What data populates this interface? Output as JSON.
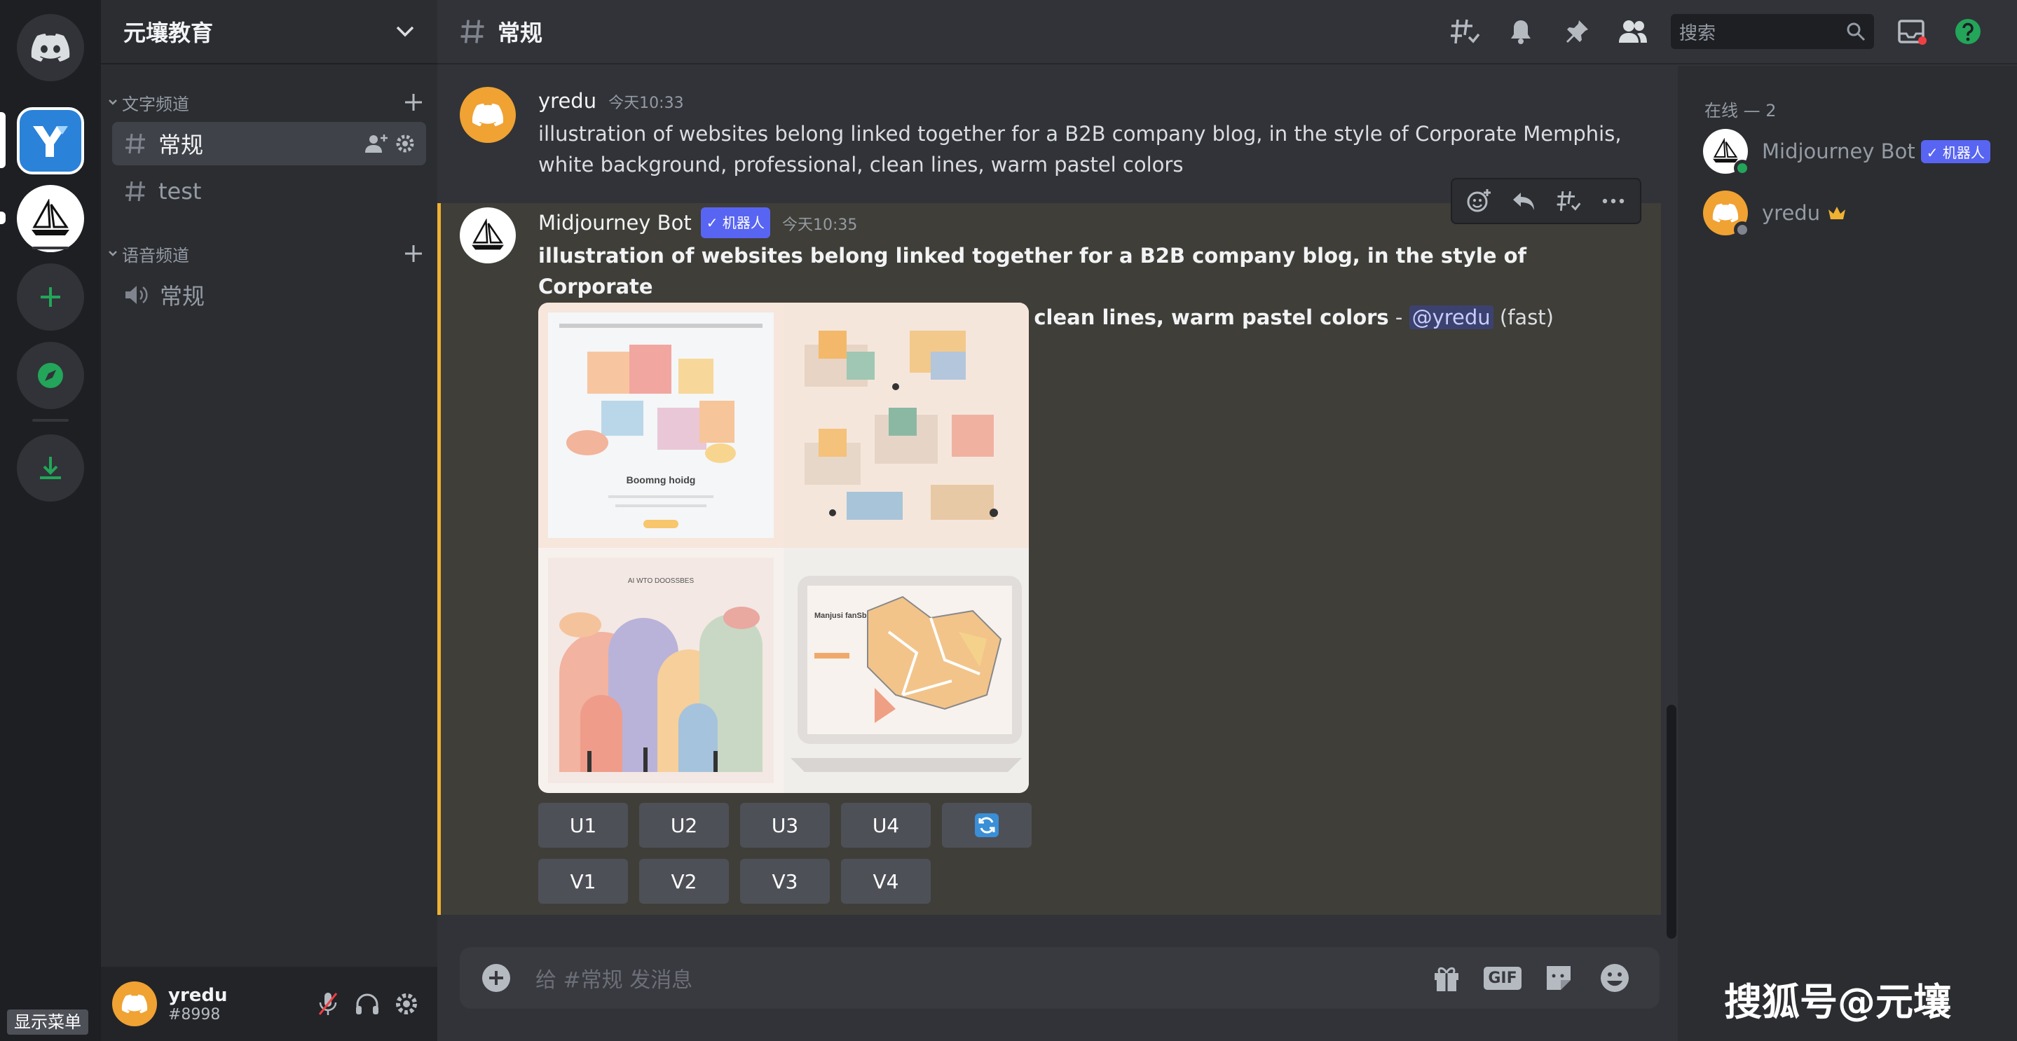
{
  "server_rail": {
    "menu_label": "显示菜单"
  },
  "sidebar": {
    "guild_name": "元壤教育",
    "categories": [
      {
        "label": "文字频道",
        "channels": [
          {
            "name": "常规"
          },
          {
            "name": "test"
          }
        ]
      },
      {
        "label": "语音频道",
        "channels": [
          {
            "name": "常规"
          }
        ]
      }
    ]
  },
  "user_panel": {
    "name": "yredu",
    "tag": "#8998"
  },
  "topbar": {
    "channel": "常规",
    "search_placeholder": "搜索"
  },
  "messages": [
    {
      "author": "yredu",
      "time": "今天10:33",
      "text_line1": "illustration of websites belong linked together for a B2B company blog, in the style of Corporate Memphis,",
      "text_line2": "white background, professional, clean lines, warm pastel colors"
    },
    {
      "author": "Midjourney Bot",
      "bot_tag": "机器人",
      "time": "今天10:35",
      "prompt_line1": "illustration of websites belong linked together for a B2B company blog, in the style of Corporate",
      "prompt_line2": "Memphis, white background, professional, clean lines, warm pastel colors",
      "separator": " - ",
      "mention": "@yredu",
      "mode": " (fast)",
      "image_texts": [
        "Boomng hoidg",
        "AI WTO DOOSSBES",
        "Manjusi fanSbueeeBeloheeg"
      ],
      "upscale_buttons": [
        "U1",
        "U2",
        "U3",
        "U4"
      ],
      "variation_buttons": [
        "V1",
        "V2",
        "V3",
        "V4"
      ]
    }
  ],
  "composer": {
    "placeholder": "给 #常规 发消息",
    "gif_label": "GIF"
  },
  "members": {
    "header": "在线 — 2",
    "list": [
      {
        "name": "Midjourney Bot",
        "tag": "机器人"
      },
      {
        "name": "yredu"
      }
    ]
  },
  "watermark": "搜狐号@元壤",
  "colors": {
    "accent": "#5865f2",
    "green": "#23a55a",
    "gold": "#f0b232",
    "avatar_orange": "#f0a232"
  }
}
